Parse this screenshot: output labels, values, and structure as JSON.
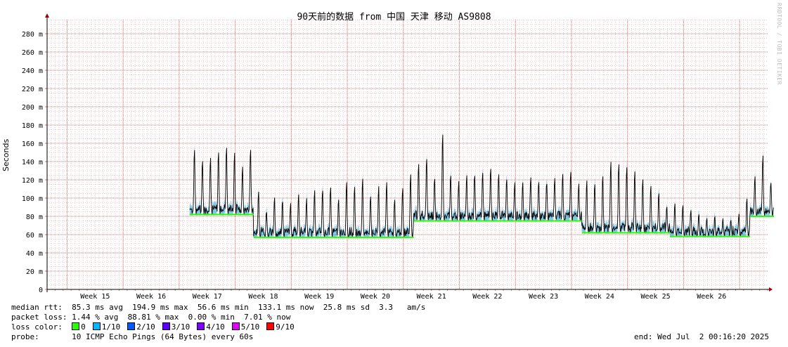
{
  "chart_data": {
    "type": "line",
    "title": "90天前的数据 from 中国 天津 移动 AS9808",
    "ylabel": "Seconds",
    "yticks": [
      "0",
      "20 m",
      "40 m",
      "60 m",
      "80 m",
      "100 m",
      "120 m",
      "140 m",
      "160 m",
      "180 m",
      "200 m",
      "220 m",
      "240 m",
      "260 m",
      "280 m"
    ],
    "ylim": [
      0,
      0.29
    ],
    "xlim_days": [
      0,
      90
    ],
    "xticks": [
      "Week 15",
      "Week 16",
      "Week 17",
      "Week 18",
      "Week 19",
      "Week 20",
      "Week 21",
      "Week 22",
      "Week 23",
      "Week 24",
      "Week 25",
      "Week 26"
    ],
    "grid": true,
    "series": [
      {
        "x_start_day": 17.8,
        "x_step_days": 1,
        "baseline_ms": [
          82,
          82,
          82,
          82,
          82,
          82,
          82,
          82,
          57,
          57,
          57,
          57,
          57,
          57,
          57,
          57,
          57,
          57,
          57,
          57,
          57,
          57,
          57,
          57,
          57,
          57,
          57,
          57,
          75,
          75,
          75,
          75,
          75,
          75,
          75,
          75,
          75,
          75,
          75,
          75,
          75,
          75,
          75,
          75,
          75,
          75,
          75,
          75,
          75,
          62,
          62,
          62,
          62,
          62,
          62,
          62,
          62,
          62,
          62,
          62,
          58,
          58,
          58,
          58,
          58,
          58,
          58,
          58,
          58,
          58,
          80,
          80,
          80
        ],
        "peak_ms": [
          175,
          160,
          165,
          172,
          178,
          170,
          150,
          175,
          120,
          95,
          112,
          110,
          105,
          118,
          112,
          122,
          125,
          128,
          110,
          135,
          130,
          140,
          115,
          128,
          135,
          110,
          125,
          148,
          155,
          165,
          135,
          198,
          140,
          130,
          138,
          140,
          145,
          150,
          140,
          135,
          128,
          130,
          135,
          132,
          130,
          135,
          140,
          145,
          128,
          135,
          132,
          145,
          162,
          160,
          158,
          150,
          138,
          130,
          118,
          100,
          105,
          100,
          95,
          90,
          85,
          88,
          82,
          82,
          90,
          112,
          135,
          165,
          130
        ]
      }
    ]
  },
  "colors": {
    "grid_minor": "#e8c8c8",
    "grid_major": "#e07070",
    "plot_line": "#000000",
    "axis_arrow": "#a00000",
    "smoke": "#1ea0d8",
    "loss_zero": "#26ff00"
  },
  "stats": {
    "median": "median rtt:  85.3 ms avg  194.9 ms max  56.6 ms min  133.1 ms now  25.8 ms sd  3.3   am/s",
    "loss": "packet loss: 1.44 % avg  88.81 % max  0.00 % min  7.01 % now",
    "loss_label": "loss color:",
    "probe": "probe:       10 ICMP Echo Pings (64 Bytes) every 60s",
    "end": "end: Wed Jul  2 00:16:20 2025"
  },
  "loss_colors": [
    {
      "label": "0",
      "color": "#26ff00"
    },
    {
      "label": "1/10",
      "color": "#00b8ff"
    },
    {
      "label": "2/10",
      "color": "#0059ff"
    },
    {
      "label": "3/10",
      "color": "#5e00ff"
    },
    {
      "label": "4/10",
      "color": "#7e00ff"
    },
    {
      "label": "5/10",
      "color": "#dd00ff"
    },
    {
      "label": "9/10",
      "color": "#ff0000"
    }
  ],
  "watermark": "RRDTOOL / TOBI OETIKER"
}
